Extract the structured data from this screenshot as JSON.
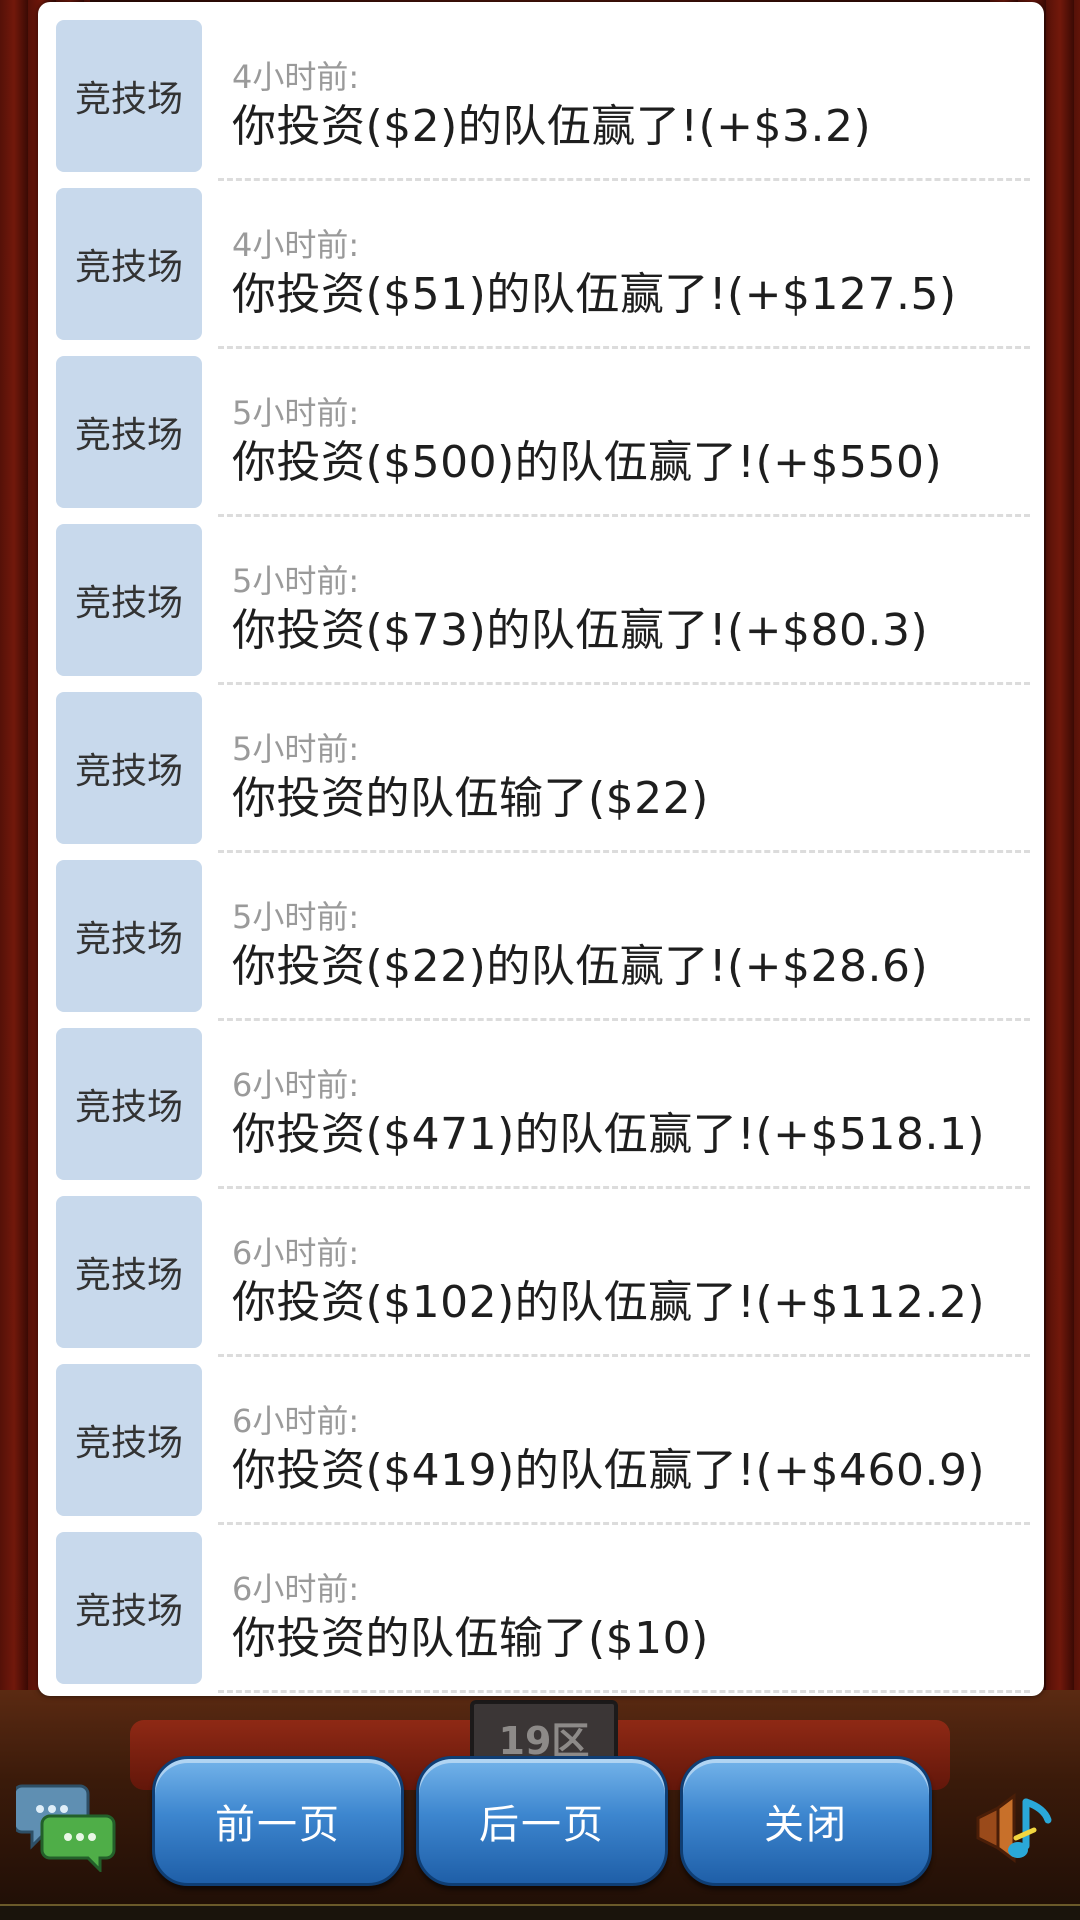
{
  "background": {
    "server_sign": "19区"
  },
  "log": {
    "items": [
      {
        "tag": "竞技场",
        "time": "4小时前:",
        "message": "你投资($2)的队伍赢了!(+$3.2)"
      },
      {
        "tag": "竞技场",
        "time": "4小时前:",
        "message": "你投资($51)的队伍赢了!(+$127.5)"
      },
      {
        "tag": "竞技场",
        "time": "5小时前:",
        "message": "你投资($500)的队伍赢了!(+$550)"
      },
      {
        "tag": "竞技场",
        "time": "5小时前:",
        "message": "你投资($73)的队伍赢了!(+$80.3)"
      },
      {
        "tag": "竞技场",
        "time": "5小时前:",
        "message": "你投资的队伍输了($22)"
      },
      {
        "tag": "竞技场",
        "time": "5小时前:",
        "message": "你投资($22)的队伍赢了!(+$28.6)"
      },
      {
        "tag": "竞技场",
        "time": "6小时前:",
        "message": "你投资($471)的队伍赢了!(+$518.1)"
      },
      {
        "tag": "竞技场",
        "time": "6小时前:",
        "message": "你投资($102)的队伍赢了!(+$112.2)"
      },
      {
        "tag": "竞技场",
        "time": "6小时前:",
        "message": "你投资($419)的队伍赢了!(+$460.9)"
      },
      {
        "tag": "竞技场",
        "time": "6小时前:",
        "message": "你投资的队伍输了($10)"
      }
    ]
  },
  "buttons": {
    "prev_label": "前一页",
    "next_label": "后一页",
    "close_label": "关闭"
  },
  "icons": {
    "chat": "chat-bubbles-icon",
    "music": "music-note-icon"
  },
  "colors": {
    "tag_bg": "#c8d9ec",
    "button_blue": "#3d86cf",
    "time_text": "#9a9a9a"
  }
}
